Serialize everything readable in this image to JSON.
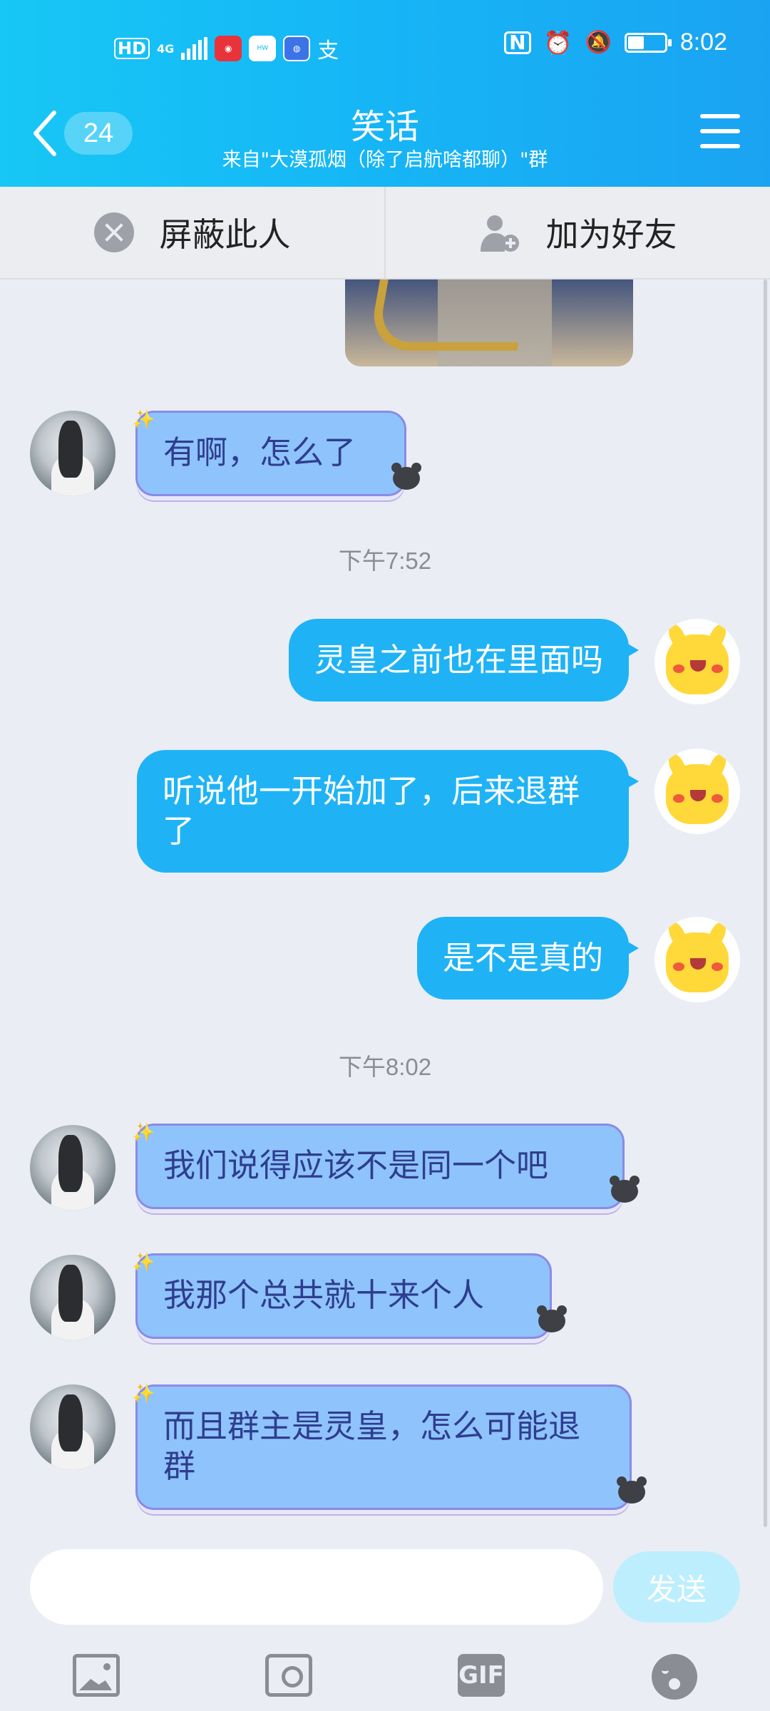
{
  "status_bar": {
    "time": "8:02",
    "hd_label": "HD",
    "network_label": "4G",
    "icons": [
      "hd-icon",
      "signal-icon",
      "app-icon",
      "huawei-icon",
      "browser-icon",
      "alipay-icon",
      "nfc-icon",
      "alarm-icon",
      "mute-icon",
      "battery-icon"
    ]
  },
  "header": {
    "back_count": "24",
    "title": "笑话",
    "subtitle": "来自\"大漠孤烟（除了启航啥都聊）\"群",
    "colors": {
      "gradient_start": "#17c7f5",
      "gradient_end": "#1aa3f2"
    }
  },
  "actions": {
    "block_label": "屏蔽此人",
    "add_friend_label": "加为好友"
  },
  "messages": [
    {
      "side": "in",
      "text": "有啊，怎么了"
    },
    {
      "type": "time",
      "text": "下午7:52"
    },
    {
      "side": "out",
      "text": "灵皇之前也在里面吗"
    },
    {
      "side": "out",
      "text": "听说他一开始加了，后来退群了"
    },
    {
      "side": "out",
      "text": "是不是真的"
    },
    {
      "type": "time",
      "text": "下午8:02"
    },
    {
      "side": "in",
      "text": "我们说得应该不是同一个吧"
    },
    {
      "side": "in",
      "text": "我那个总共就十来个人"
    },
    {
      "side": "in",
      "text": "而且群主是灵皇，怎么可能退群"
    }
  ],
  "composer": {
    "input_value": "",
    "send_label": "发送",
    "tools": [
      "image-icon",
      "camera-icon",
      "gif-icon",
      "emoji-icon"
    ],
    "gif_label": "GIF"
  },
  "colors": {
    "outgoing_bubble": "#1fb3f6",
    "incoming_bubble": "#8fc3fb",
    "background": "#eaedf4"
  }
}
